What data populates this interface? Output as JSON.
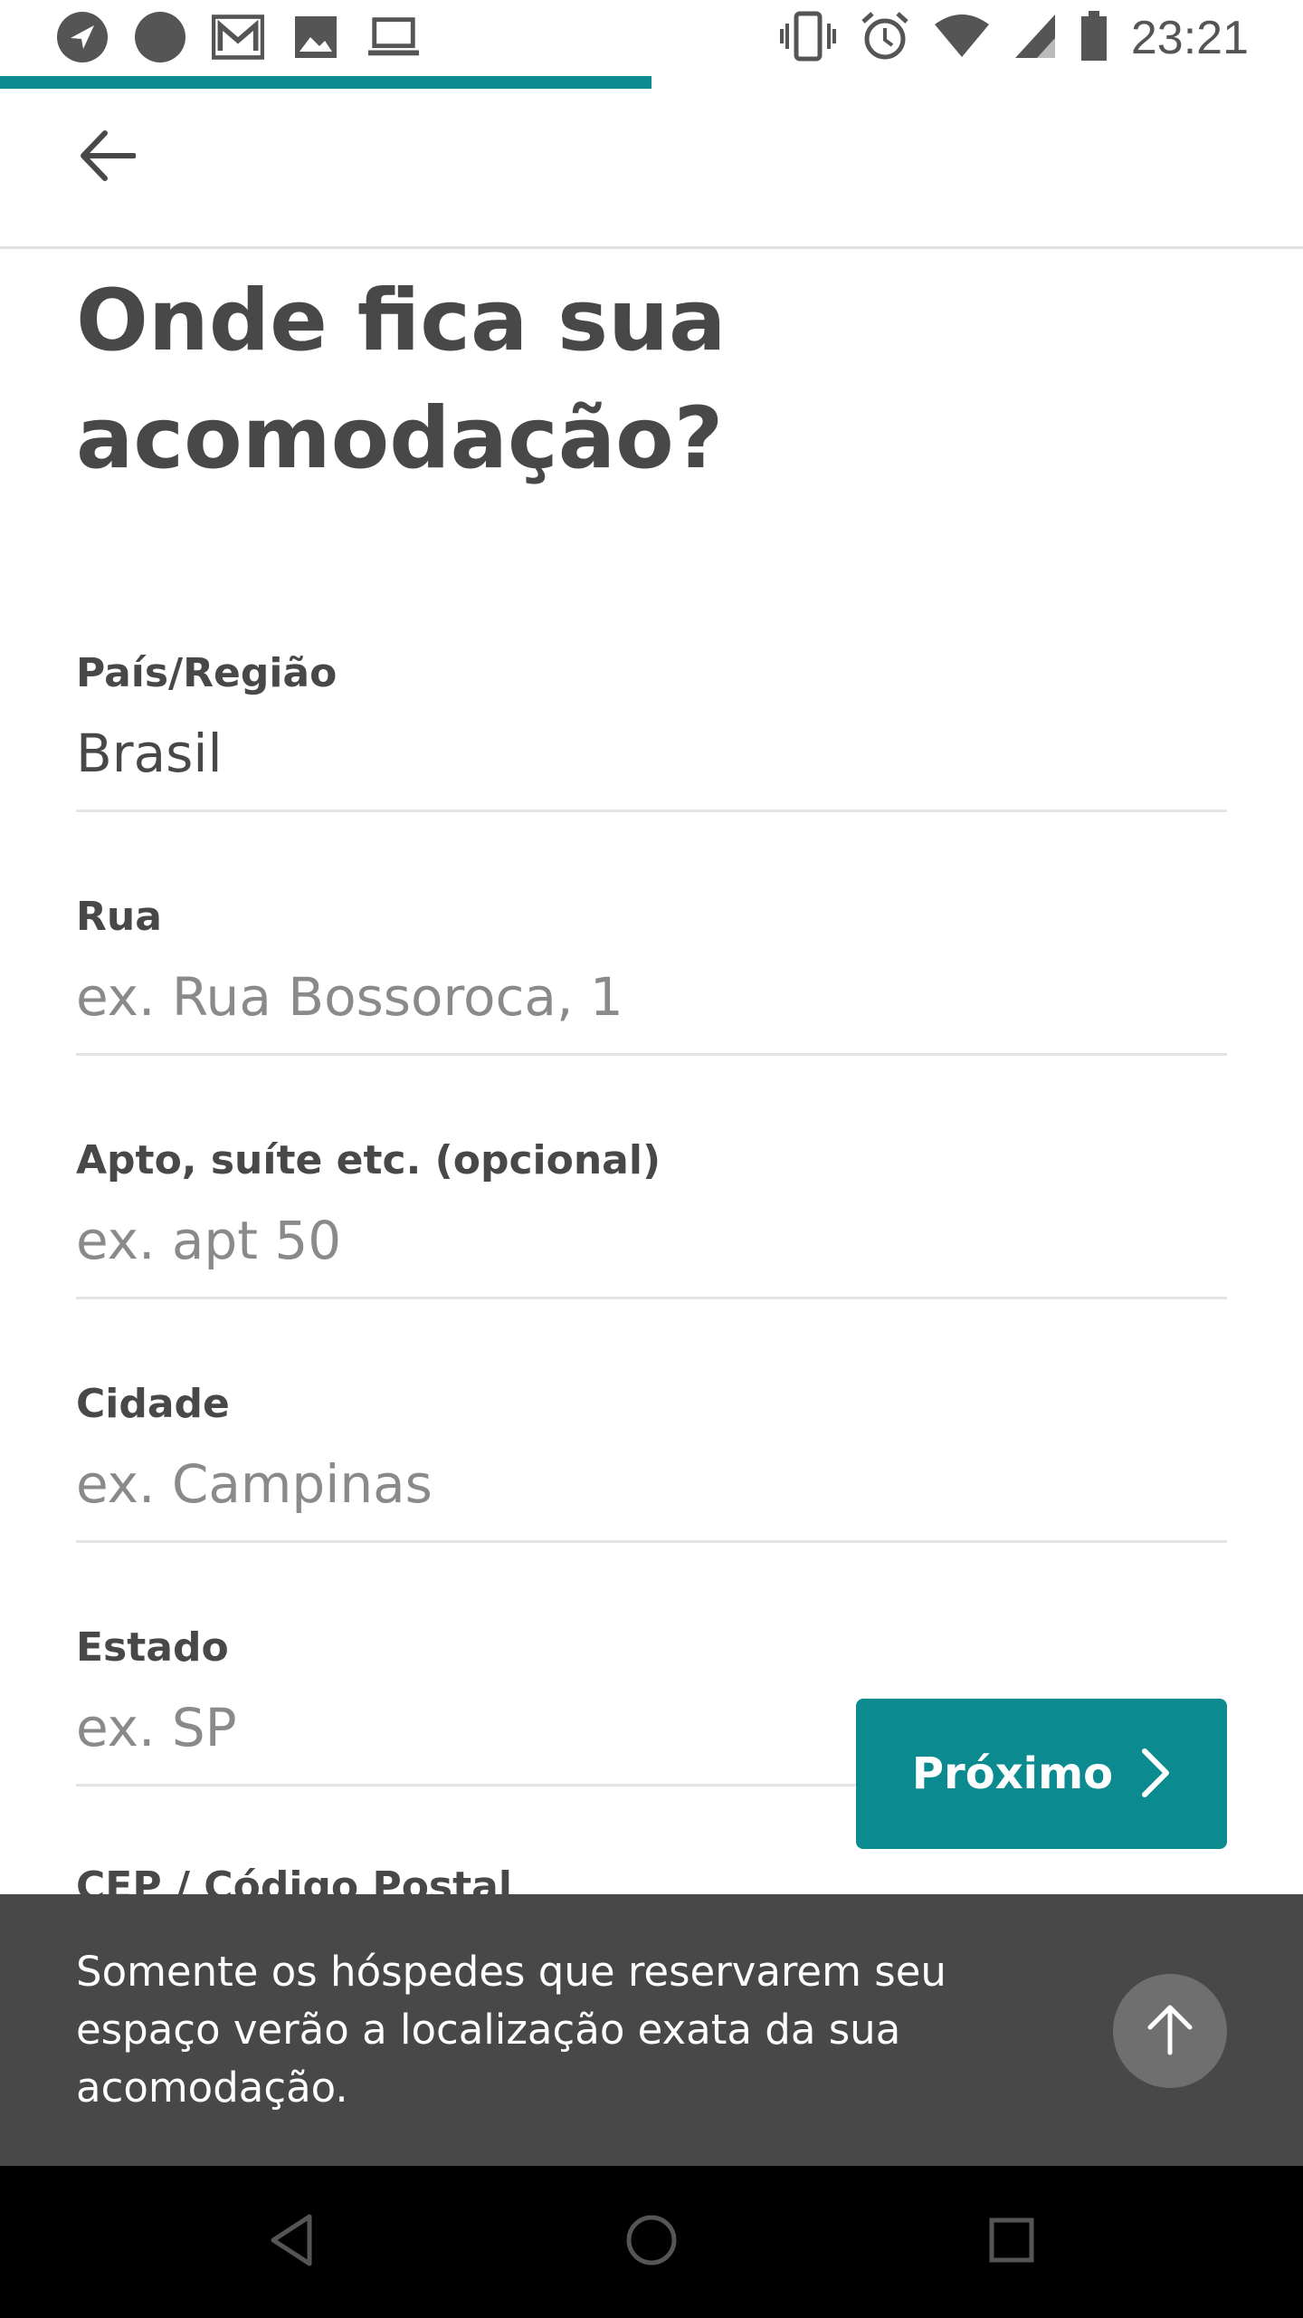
{
  "status_bar": {
    "time": "23:21",
    "left_icons": [
      "navigation-icon",
      "circle-icon",
      "gmail-icon",
      "image-icon",
      "laptop-icon"
    ],
    "right_icons": [
      "vibrate-icon",
      "alarm-icon",
      "wifi-icon",
      "signal-icon",
      "battery-icon"
    ]
  },
  "progress": {
    "fraction": 0.5,
    "color": "#0b8a8f"
  },
  "header": {
    "back_icon": "arrow-left-icon"
  },
  "page": {
    "title": "Onde fica sua acomodação?"
  },
  "form": {
    "fields": [
      {
        "label": "País/Região",
        "value": "Brasil",
        "placeholder": ""
      },
      {
        "label": "Rua",
        "value": "",
        "placeholder": "ex. Rua Bossoroca, 1"
      },
      {
        "label": "Apto, suíte etc. (opcional)",
        "value": "",
        "placeholder": "ex. apt 50"
      },
      {
        "label": "Cidade",
        "value": "",
        "placeholder": "ex. Campinas"
      },
      {
        "label": "Estado",
        "value": "",
        "placeholder": "ex. SP"
      }
    ],
    "next_field_label": "CEP / Código Postal"
  },
  "next_button": {
    "label": "Próximo",
    "icon": "chevron-right-icon"
  },
  "info": {
    "text": "Somente os hóspedes que reservarem seu espaço verão a localização exata da sua acomodação.",
    "scroll_icon": "arrow-up-icon"
  },
  "nav": {
    "icons": [
      "back-triangle-icon",
      "home-circle-icon",
      "recents-square-icon"
    ]
  },
  "colors": {
    "accent": "#0b8a8f",
    "text": "#484848",
    "panel": "#484848"
  }
}
